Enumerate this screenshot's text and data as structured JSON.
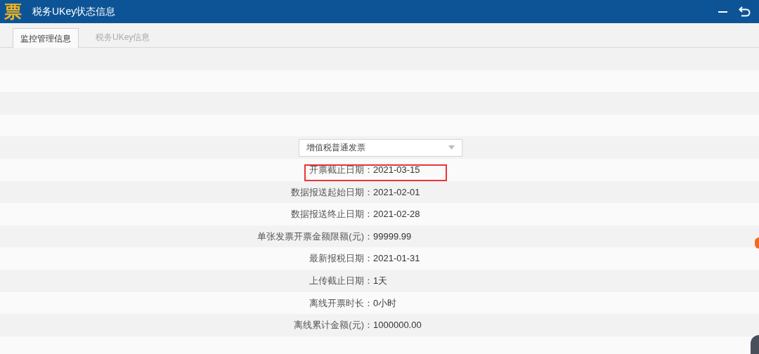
{
  "window": {
    "title": "税务UKey状态信息",
    "logo": "票"
  },
  "tabs": [
    {
      "label": "监控管理信息",
      "selected": true
    },
    {
      "label": "税务UKey信息",
      "selected": false
    }
  ],
  "invoice_type": {
    "value": "增值税普通发票"
  },
  "fields": [
    {
      "label": "开票截止日期：",
      "value": "2021-03-15",
      "highlighted": true
    },
    {
      "label": "数据报送起始日期：",
      "value": "2021-02-01",
      "highlighted": false
    },
    {
      "label": "数据报送终止日期：",
      "value": "2021-02-28",
      "highlighted": false
    },
    {
      "label": "单张发票开票金额限额(元)：",
      "value": "99999.99",
      "highlighted": false
    },
    {
      "label": "最新报税日期：",
      "value": "2021-01-31",
      "highlighted": false
    },
    {
      "label": "上传截止日期：",
      "value": "1天",
      "highlighted": false
    },
    {
      "label": "离线开票时长：",
      "value": "0小时",
      "highlighted": false
    },
    {
      "label": "离线累计金额(元)：",
      "value": "1000000.00",
      "highlighted": false
    }
  ]
}
